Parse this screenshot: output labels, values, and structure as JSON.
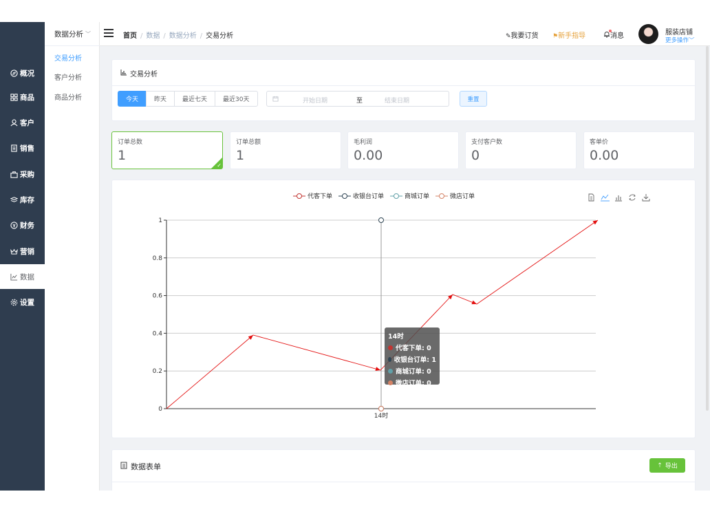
{
  "sidebar": {
    "items": [
      {
        "label": "概况",
        "icon": "compass-icon"
      },
      {
        "label": "商品",
        "icon": "grid-icon"
      },
      {
        "label": "客户",
        "icon": "user-icon"
      },
      {
        "label": "销售",
        "icon": "document-icon"
      },
      {
        "label": "采购",
        "icon": "bag-icon"
      },
      {
        "label": "库存",
        "icon": "layers-icon"
      },
      {
        "label": "财务",
        "icon": "coin-icon"
      },
      {
        "label": "营销",
        "icon": "crown-icon"
      },
      {
        "label": "数据",
        "icon": "chart-line-icon"
      },
      {
        "label": "设置",
        "icon": "gear-icon"
      }
    ],
    "active": "数据"
  },
  "submenu": {
    "title": "数据分析",
    "items": [
      "交易分析",
      "客户分析",
      "商品分析"
    ],
    "active": "交易分析"
  },
  "header": {
    "breadcrumb": [
      "首页",
      "数据",
      "数据分析",
      "交易分析"
    ],
    "order_link": "我要订货",
    "guide_link": "新手指导",
    "message_link": "消息",
    "store_name": "服装店铺",
    "more_actions": "更多操作"
  },
  "analysis": {
    "title": "交易分析",
    "ranges": [
      "今天",
      "昨天",
      "最近七天",
      "最近30天"
    ],
    "active_range": "今天",
    "start_placeholder": "开始日期",
    "range_separator": "至",
    "end_placeholder": "结束日期",
    "reset_label": "重置"
  },
  "stats": [
    {
      "label": "订单总数",
      "value": "1"
    },
    {
      "label": "订单总额",
      "value": "1"
    },
    {
      "label": "毛利润",
      "value": "0.00"
    },
    {
      "label": "支付客户数",
      "value": "0"
    },
    {
      "label": "客单价",
      "value": "0.00"
    }
  ],
  "colors": {
    "primary": "#409eff",
    "success": "#67c23a",
    "sidebar_bg": "#2f3d4f",
    "guide": "#e6a23c"
  },
  "tooltip": {
    "title": "14时",
    "rows": [
      {
        "label": "代客下单: 0",
        "color": "#c23531"
      },
      {
        "label": "收银台订单: 1",
        "color": "#2f4554"
      },
      {
        "label": "商城订单: 0",
        "color": "#61a0a8"
      },
      {
        "label": "微店订单: 0",
        "color": "#d48265"
      }
    ]
  },
  "chart_data": {
    "type": "line",
    "categories": [
      "14时"
    ],
    "series": [
      {
        "name": "代客下单",
        "color": "#c23531",
        "values": [
          0
        ]
      },
      {
        "name": "收银台订单",
        "color": "#2f4554",
        "values": [
          1
        ]
      },
      {
        "name": "商城订单",
        "color": "#61a0a8",
        "values": [
          0
        ]
      },
      {
        "name": "微店订单",
        "color": "#d48265",
        "values": [
          0
        ]
      }
    ],
    "yticks": [
      "0",
      "0.2",
      "0.4",
      "0.6",
      "0.8",
      "1"
    ],
    "ylim": [
      0,
      1
    ],
    "legend_position": "top-center",
    "grid": true
  },
  "datatable": {
    "title": "数据表单",
    "export_label": "导出"
  }
}
